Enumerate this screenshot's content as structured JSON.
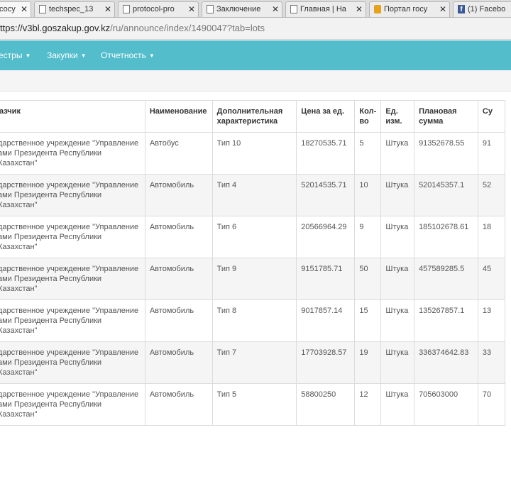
{
  "browser": {
    "tabs": [
      {
        "title": "сосу",
        "icon": "none",
        "active": true
      },
      {
        "title": "techspec_13",
        "icon": "page-icon"
      },
      {
        "title": "protocol-pro",
        "icon": "page-icon"
      },
      {
        "title": "Заключение",
        "icon": "page-icon"
      },
      {
        "title": "Главная | На",
        "icon": "page-icon"
      },
      {
        "title": "Портал госу",
        "icon": "portal-icon"
      },
      {
        "title": "(1) Facebo",
        "icon": "facebook-icon"
      }
    ],
    "url_main": "ttps://v3bl.goszakup.gov.kz",
    "url_path": "/ru/announce/index/1490047?tab=lots"
  },
  "nav": {
    "items": [
      {
        "label": "естры"
      },
      {
        "label": "Закупки"
      },
      {
        "label": "Отчетность"
      }
    ]
  },
  "table": {
    "headers": {
      "customer": "азчик",
      "name": "Наименование",
      "extra": "Дополнительная характеристика",
      "price": "Цена за ед.",
      "qty": "Кол-во",
      "unit": "Ед. изм.",
      "plan": "Плановая сумма",
      "sum": "Су"
    },
    "rows": [
      {
        "customer": "дарственное учреждение \"Управление ами Президента Республики Казахстан\"",
        "name": "Автобус",
        "extra": "Тип 10",
        "price": "18270535.71",
        "qty": "5",
        "unit": "Штука",
        "plan": "91352678.55",
        "sum": "91"
      },
      {
        "customer": "дарственное учреждение \"Управление ами Президента Республики Казахстан\"",
        "name": "Автомобиль",
        "extra": "Тип 4",
        "price": "52014535.71",
        "qty": "10",
        "unit": "Штука",
        "plan": "520145357.1",
        "sum": "52"
      },
      {
        "customer": "дарственное учреждение \"Управление ами Президента Республики Казахстан\"",
        "name": "Автомобиль",
        "extra": "Тип 6",
        "price": "20566964.29",
        "qty": "9",
        "unit": "Штука",
        "plan": "185102678.61",
        "sum": "18"
      },
      {
        "customer": "дарственное учреждение \"Управление ами Президента Республики Казахстан\"",
        "name": "Автомобиль",
        "extra": "Тип 9",
        "price": "9151785.71",
        "qty": "50",
        "unit": "Штука",
        "plan": "457589285.5",
        "sum": "45"
      },
      {
        "customer": "дарственное учреждение \"Управление ами Президента Республики Казахстан\"",
        "name": "Автомобиль",
        "extra": "Тип 8",
        "price": "9017857.14",
        "qty": "15",
        "unit": "Штука",
        "plan": "135267857.1",
        "sum": "13"
      },
      {
        "customer": "дарственное учреждение \"Управление ами Президента Республики Казахстан\"",
        "name": "Автомобиль",
        "extra": "Тип 7",
        "price": "17703928.57",
        "qty": "19",
        "unit": "Штука",
        "plan": "336374642.83",
        "sum": "33"
      },
      {
        "customer": "дарственное учреждение \"Управление ами Президента Республики Казахстан\"",
        "name": "Автомобиль",
        "extra": "Тип 5",
        "price": "58800250",
        "qty": "12",
        "unit": "Штука",
        "plan": "705603000",
        "sum": "70"
      }
    ]
  },
  "colors": {
    "navbar": "#53bdcc",
    "row_alt": "#f5f5f5",
    "border": "#dcdcdc"
  }
}
